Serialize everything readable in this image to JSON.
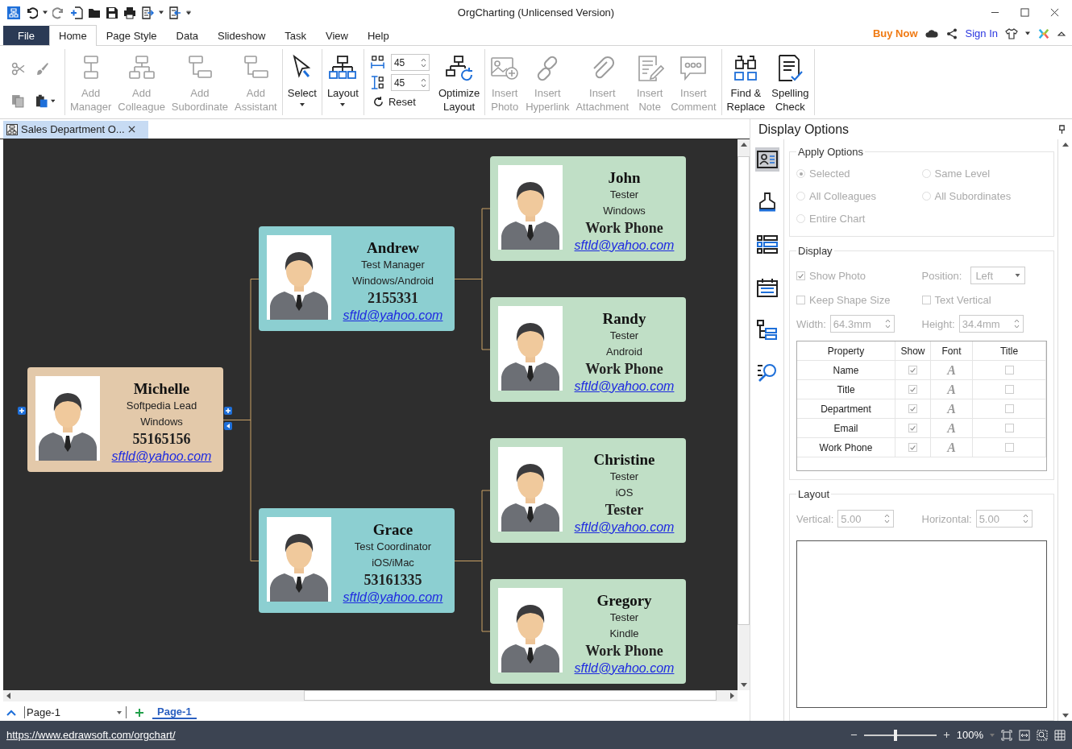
{
  "window": {
    "title": "OrgCharting (Unlicensed Version)"
  },
  "menu": {
    "file": "File",
    "tabs": [
      {
        "label": "Home",
        "selected": true
      },
      {
        "label": "Page Style",
        "selected": false
      },
      {
        "label": "Data",
        "selected": false
      },
      {
        "label": "Slideshow",
        "selected": false
      },
      {
        "label": "Task",
        "selected": false
      },
      {
        "label": "View",
        "selected": false
      },
      {
        "label": "Help",
        "selected": false
      }
    ],
    "buy_now": "Buy Now",
    "sign_in": "Sign In"
  },
  "ribbon": {
    "add_buttons": [
      {
        "kind": "manager",
        "label": "Add\nManager",
        "disabled": true
      },
      {
        "kind": "colleague",
        "label": "Add\nColleague",
        "disabled": true
      },
      {
        "kind": "subordinate",
        "label": "Add\nSubordinate",
        "disabled": true
      },
      {
        "kind": "assistant",
        "label": "Add\nAssistant",
        "disabled": true
      }
    ],
    "select": {
      "label": "Select"
    },
    "layout": {
      "label": "Layout"
    },
    "spacing": {
      "horizontal": "45",
      "vertical": "45",
      "reset": "Reset"
    },
    "optimize": {
      "label": "Optimize\nLayout"
    },
    "insert_buttons": [
      {
        "kind": "photo",
        "label": "Insert\nPhoto",
        "disabled": true
      },
      {
        "kind": "hyperlink",
        "label": "Insert\nHyperlink",
        "disabled": true
      },
      {
        "kind": "attachment",
        "label": "Insert\nAttachment",
        "disabled": true
      },
      {
        "kind": "note",
        "label": "Insert\nNote",
        "disabled": true
      },
      {
        "kind": "comment",
        "label": "Insert\nComment",
        "disabled": true
      }
    ],
    "tool_buttons": [
      {
        "kind": "find",
        "label": "Find &\nReplace",
        "disabled": false
      },
      {
        "kind": "spelling",
        "label": "Spelling\nCheck",
        "disabled": false
      }
    ]
  },
  "document_tab": {
    "title": "Sales Department O..."
  },
  "chart": {
    "root": {
      "name": "Michelle",
      "title": "Softpedia Lead",
      "department": "Windows",
      "phone": "55165156",
      "email": "sftld@yahoo.com",
      "color": "#e3c9aa",
      "children": [
        {
          "name": "Andrew",
          "title": "Test Manager",
          "department": "Windows/Android",
          "phone": "2155331",
          "email": "sftld@yahoo.com",
          "color": "#8ccfd1",
          "children": [
            {
              "name": "John",
              "title": "Tester",
              "department": "Windows",
              "phone": "Work Phone",
              "email": "sftld@yahoo.com",
              "color": "#c0dfc6"
            },
            {
              "name": "Randy",
              "title": "Tester",
              "department": "Android",
              "phone": "Work Phone",
              "email": "sftld@yahoo.com",
              "color": "#c0dfc6"
            }
          ]
        },
        {
          "name": "Grace",
          "title": "Test Coordinator",
          "department": "iOS/iMac",
          "phone": "53161335",
          "email": "sftld@yahoo.com",
          "color": "#8ccfd1",
          "children": [
            {
              "name": "Christine",
              "title": "Tester",
              "department": "iOS",
              "phone": "Tester",
              "email": "sftld@yahoo.com",
              "color": "#c0dfc6"
            },
            {
              "name": "Gregory",
              "title": "Tester",
              "department": "Kindle",
              "phone": "Work Phone",
              "email": "sftld@yahoo.com",
              "color": "#c0dfc6"
            }
          ]
        }
      ]
    }
  },
  "page_bar": {
    "dropdown": "Page-1",
    "tabs": [
      {
        "label": "Page-1",
        "selected": true
      }
    ]
  },
  "panel": {
    "title": "Display Options",
    "tabs": [
      {
        "kind": "card",
        "selected": true
      },
      {
        "kind": "brush",
        "selected": false
      },
      {
        "kind": "list",
        "selected": false
      },
      {
        "kind": "calendar",
        "selected": false
      },
      {
        "kind": "tree",
        "selected": false
      },
      {
        "kind": "search",
        "selected": false
      }
    ],
    "apply_options": {
      "title": "Apply Options",
      "disabled": true,
      "options": [
        {
          "label": "Selected",
          "selected": true
        },
        {
          "label": "Same Level",
          "selected": false
        },
        {
          "label": "All Colleagues",
          "selected": false
        },
        {
          "label": "All Subordinates",
          "selected": false
        },
        {
          "label": "Entire Chart",
          "selected": false
        }
      ]
    },
    "display": {
      "title": "Display",
      "disabled": true,
      "show_photo": {
        "label": "Show Photo",
        "checked": true
      },
      "position": {
        "label": "Position:",
        "value": "Left"
      },
      "keep_shape_size": {
        "label": "Keep Shape Size",
        "checked": false
      },
      "text_vertical": {
        "label": "Text Vertical",
        "checked": false
      },
      "width": {
        "label": "Width:",
        "value": "64.3mm"
      },
      "height": {
        "label": "Height:",
        "value": "34.4mm"
      },
      "table": {
        "columns": [
          "Property",
          "Show",
          "Font",
          "Title"
        ],
        "rows": [
          {
            "property": "Name",
            "show": true,
            "font": "A",
            "title": false
          },
          {
            "property": "Title",
            "show": true,
            "font": "A",
            "title": false
          },
          {
            "property": "Department",
            "show": true,
            "font": "A",
            "title": false
          },
          {
            "property": "Email",
            "show": true,
            "font": "A",
            "title": false
          },
          {
            "property": "Work Phone",
            "show": true,
            "font": "A",
            "title": false
          }
        ]
      }
    },
    "layout": {
      "title": "Layout",
      "disabled": true,
      "vertical": {
        "label": "Vertical:",
        "value": "5.00"
      },
      "horizontal": {
        "label": "Horizontal:",
        "value": "5.00"
      }
    }
  },
  "status_bar": {
    "url": "https://www.edrawsoft.com/orgchart/",
    "zoom": {
      "level": 0.44,
      "reading": "100%"
    }
  }
}
